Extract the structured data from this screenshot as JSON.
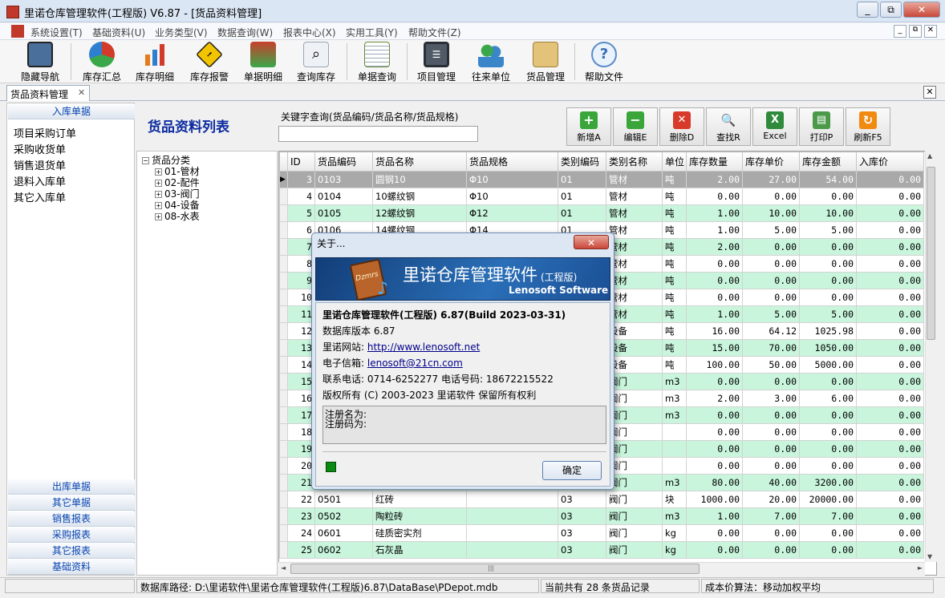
{
  "window": {
    "title": "里诺仓库管理软件(工程版) V6.87 - [货品资料管理]",
    "min": "▭",
    "max": "⧉",
    "close": "✕"
  },
  "menubar": {
    "items": [
      "系统设置(T)",
      "基础资料(U)",
      "业务类型(V)",
      "数据查询(W)",
      "报表中心(X)",
      "实用工具(Y)",
      "帮助文件(Z)"
    ]
  },
  "toolbar": {
    "items": [
      {
        "label": "隐藏导航",
        "icon": "monitor-icon",
        "color": "#4a6f9a"
      },
      {
        "label": "库存汇总",
        "icon": "pie-chart-icon",
        "color": "#3aa84a"
      },
      {
        "label": "库存明细",
        "icon": "bar-chart-icon",
        "color": "#e47c1c"
      },
      {
        "label": "库存报警",
        "icon": "warning-icon",
        "color": "#f2c300"
      },
      {
        "label": "单据明细",
        "icon": "line-chart-icon",
        "color": "#c8402c"
      },
      {
        "label": "查询库存",
        "icon": "magnifier-doc-icon",
        "color": "#9aa7b6"
      },
      {
        "label": "单据查询",
        "icon": "document-pen-icon",
        "color": "#6a8a3a"
      },
      {
        "label": "项目管理",
        "icon": "checklist-icon",
        "color": "#505a66"
      },
      {
        "label": "往来单位",
        "icon": "people-icon",
        "color": "#3a86c8"
      },
      {
        "label": "货品管理",
        "icon": "box-icon",
        "color": "#c9a24a"
      },
      {
        "label": "帮助文件",
        "icon": "help-icon",
        "color": "#5a8cc8"
      }
    ]
  },
  "tab": {
    "label": "货品资料管理",
    "close": "✕"
  },
  "leftnav": {
    "top_head": "入库单据",
    "links": [
      "项目采购订单",
      "采购收货单",
      "销售退货单",
      "退料入库单",
      "其它入库单"
    ],
    "bottom_heads": [
      "出库单据",
      "其它单据",
      "销售报表",
      "采购报表",
      "其它报表",
      "基础资料"
    ]
  },
  "list": {
    "title": "货品资料列表",
    "keyword_label": "关键字查询(货品编码/货品名称/货品规格)",
    "keyword_value": ""
  },
  "actions": [
    {
      "label": "新增A",
      "glyph": "+",
      "color": "#3aa63a"
    },
    {
      "label": "编辑E",
      "glyph": "−",
      "color": "#3aa63a"
    },
    {
      "label": "删除D",
      "glyph": "✕",
      "color": "#d73a2a"
    },
    {
      "label": "查找R",
      "glyph": "🔍",
      "color": "#3a7ac8"
    },
    {
      "label": "Excel",
      "glyph": "X",
      "color": "#2f8a3c"
    },
    {
      "label": "打印P",
      "glyph": "▤",
      "color": "#4a9a4a"
    },
    {
      "label": "刷新F5",
      "glyph": "↻",
      "color": "#f08a10"
    }
  ],
  "tree": {
    "root": "货品分类",
    "children": [
      "01-管材",
      "02-配件",
      "03-阀门",
      "04-设备",
      "08-水表"
    ]
  },
  "grid": {
    "headers": [
      "ID",
      "货品编码",
      "货品名称",
      "货品规格",
      "类别编码",
      "类别名称",
      "单位",
      "库存数量",
      "库存单价",
      "库存金额",
      "入库价"
    ],
    "rows": [
      [
        "3",
        "0103",
        "圆钢10",
        "Φ10",
        "01",
        "管材",
        "吨",
        "2.00",
        "27.00",
        "54.00",
        "0.00"
      ],
      [
        "4",
        "0104",
        "10螺纹钢",
        "Φ10",
        "01",
        "管材",
        "吨",
        "0.00",
        "0.00",
        "0.00",
        "0.00"
      ],
      [
        "5",
        "0105",
        "12螺纹钢",
        "Φ12",
        "01",
        "管材",
        "吨",
        "1.00",
        "10.00",
        "10.00",
        "0.00"
      ],
      [
        "6",
        "0106",
        "14螺纹钢",
        "Φ14",
        "01",
        "管材",
        "吨",
        "1.00",
        "5.00",
        "5.00",
        "0.00"
      ],
      [
        "7",
        "",
        "",
        "",
        "",
        "管材",
        "吨",
        "2.00",
        "0.00",
        "0.00",
        "0.00"
      ],
      [
        "8",
        "",
        "",
        "",
        "",
        "管材",
        "吨",
        "0.00",
        "0.00",
        "0.00",
        "0.00"
      ],
      [
        "9",
        "",
        "",
        "",
        "",
        "管材",
        "吨",
        "0.00",
        "0.00",
        "0.00",
        "0.00"
      ],
      [
        "10",
        "",
        "",
        "",
        "",
        "管材",
        "吨",
        "0.00",
        "0.00",
        "0.00",
        "0.00"
      ],
      [
        "11",
        "",
        "",
        "",
        "",
        "管材",
        "吨",
        "1.00",
        "5.00",
        "5.00",
        "0.00"
      ],
      [
        "12",
        "",
        "",
        "",
        "",
        "设备",
        "吨",
        "16.00",
        "64.12",
        "1025.98",
        "0.00"
      ],
      [
        "13",
        "",
        "",
        "",
        "",
        "设备",
        "吨",
        "15.00",
        "70.00",
        "1050.00",
        "0.00"
      ],
      [
        "14",
        "",
        "",
        "",
        "",
        "设备",
        "吨",
        "100.00",
        "50.00",
        "5000.00",
        "0.00"
      ],
      [
        "15",
        "",
        "",
        "",
        "",
        "阀门",
        "m3",
        "0.00",
        "0.00",
        "0.00",
        "0.00"
      ],
      [
        "16",
        "",
        "",
        "",
        "",
        "阀门",
        "m3",
        "2.00",
        "3.00",
        "6.00",
        "0.00"
      ],
      [
        "17",
        "",
        "",
        "",
        "",
        "阀门",
        "m3",
        "0.00",
        "0.00",
        "0.00",
        "0.00"
      ],
      [
        "18",
        "",
        "",
        "",
        "",
        "阀门",
        "",
        "0.00",
        "0.00",
        "0.00",
        "0.00"
      ],
      [
        "19",
        "",
        "",
        "",
        "",
        "阀门",
        "",
        "0.00",
        "0.00",
        "0.00",
        "0.00"
      ],
      [
        "20",
        "",
        "",
        "",
        "",
        "阀门",
        "",
        "0.00",
        "0.00",
        "0.00",
        "0.00"
      ],
      [
        "21",
        "",
        "",
        "",
        "",
        "阀门",
        "m3",
        "80.00",
        "40.00",
        "3200.00",
        "0.00"
      ],
      [
        "22",
        "0501",
        "红砖",
        "",
        "03",
        "阀门",
        "块",
        "1000.00",
        "20.00",
        "20000.00",
        "0.00"
      ],
      [
        "23",
        "0502",
        "陶粒砖",
        "",
        "03",
        "阀门",
        "m3",
        "1.00",
        "7.00",
        "7.00",
        "0.00"
      ],
      [
        "24",
        "0601",
        "硅质密实剂",
        "",
        "03",
        "阀门",
        "kg",
        "0.00",
        "0.00",
        "0.00",
        "0.00"
      ],
      [
        "25",
        "0602",
        "石灰晶",
        "",
        "03",
        "阀门",
        "kg",
        "0.00",
        "0.00",
        "0.00",
        "0.00"
      ]
    ]
  },
  "scroll": {
    "up": "▲",
    "down": "▼",
    "left": "◄",
    "right": "►",
    "grip": "|||"
  },
  "status": {
    "db_path": "数据库路径: D:\\里诺软件\\里诺仓库管理软件(工程版)6.87\\DataBase\\PDepot.mdb",
    "count": "当前共有 28 条货品记录",
    "cost_method": "成本价算法：移动加权平均"
  },
  "about": {
    "title": "关于...",
    "close": "✕",
    "banner_cn": "里诺仓库管理软件",
    "banner_edition": "(工程版)",
    "banner_en": "Lenosoft Software",
    "logo_text": "Dzmrs",
    "product": "里诺仓库管理软件(工程版) 6.87(Build 2023-03-31)",
    "db_version": "数据库版本 6.87",
    "site_label": "里诺网站:",
    "site_url": "http://www.lenosoft.net",
    "email_label": "电子信箱:",
    "email": "lenosoft@21cn.com",
    "phone": "联系电话: 0714-6252277  电话号码: 18672215522",
    "copyright": "版权所有 (C) 2003-2023 里诺软件 保留所有权利",
    "reg_name": "注册名为:",
    "reg_code": "注册码为:",
    "ok": "确定"
  }
}
